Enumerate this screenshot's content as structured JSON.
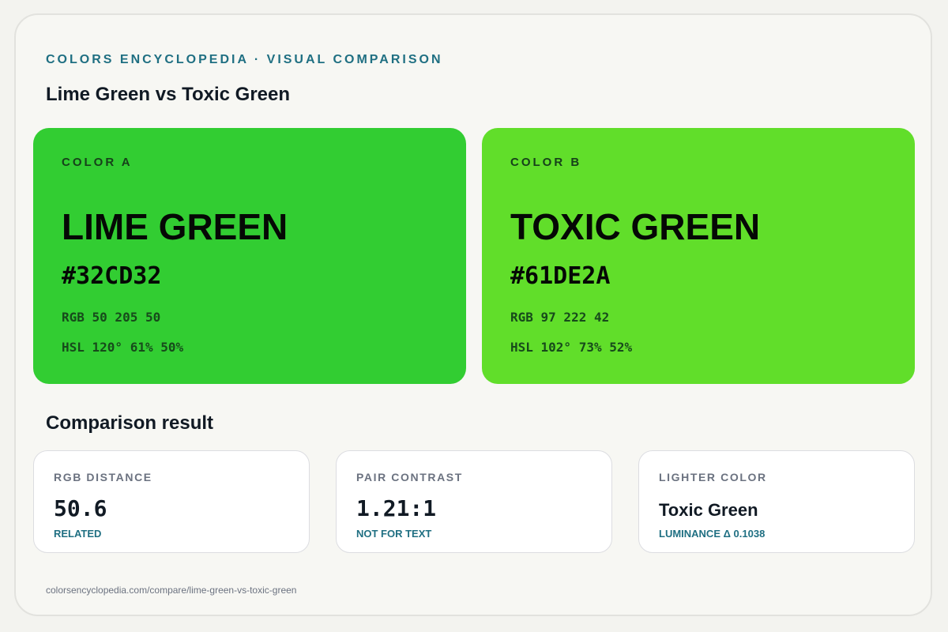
{
  "header": {
    "eyebrow": "COLORS ENCYCLOPEDIA · VISUAL COMPARISON",
    "title": "Lime Green vs Toxic Green"
  },
  "colors": [
    {
      "label": "COLOR A",
      "name": "Lime Green",
      "hex": "#32CD32",
      "rgb": "RGB 50 205 50",
      "hsl": "HSL 120° 61% 50%",
      "swatch_color": "#32CD32"
    },
    {
      "label": "COLOR B",
      "name": "Toxic Green",
      "hex": "#61DE2A",
      "rgb": "RGB 97 222 42",
      "hsl": "HSL 102° 73% 52%",
      "swatch_color": "#61DE2A"
    }
  ],
  "comparison": {
    "title": "Comparison result",
    "cards": [
      {
        "label": "RGB DISTANCE",
        "value": "50.6",
        "note": "RELATED"
      },
      {
        "label": "PAIR CONTRAST",
        "value": "1.21:1",
        "note": "NOT FOR TEXT"
      },
      {
        "label": "LIGHTER COLOR",
        "value": "Toxic Green",
        "note": "LUMINANCE Δ 0.1038"
      }
    ]
  },
  "footer": {
    "url": "colorsencyclopedia.com/compare/lime-green-vs-toxic-green"
  },
  "theme": {
    "accent": "#1f6f82",
    "text": "#111a24",
    "muted": "#6b7280"
  }
}
